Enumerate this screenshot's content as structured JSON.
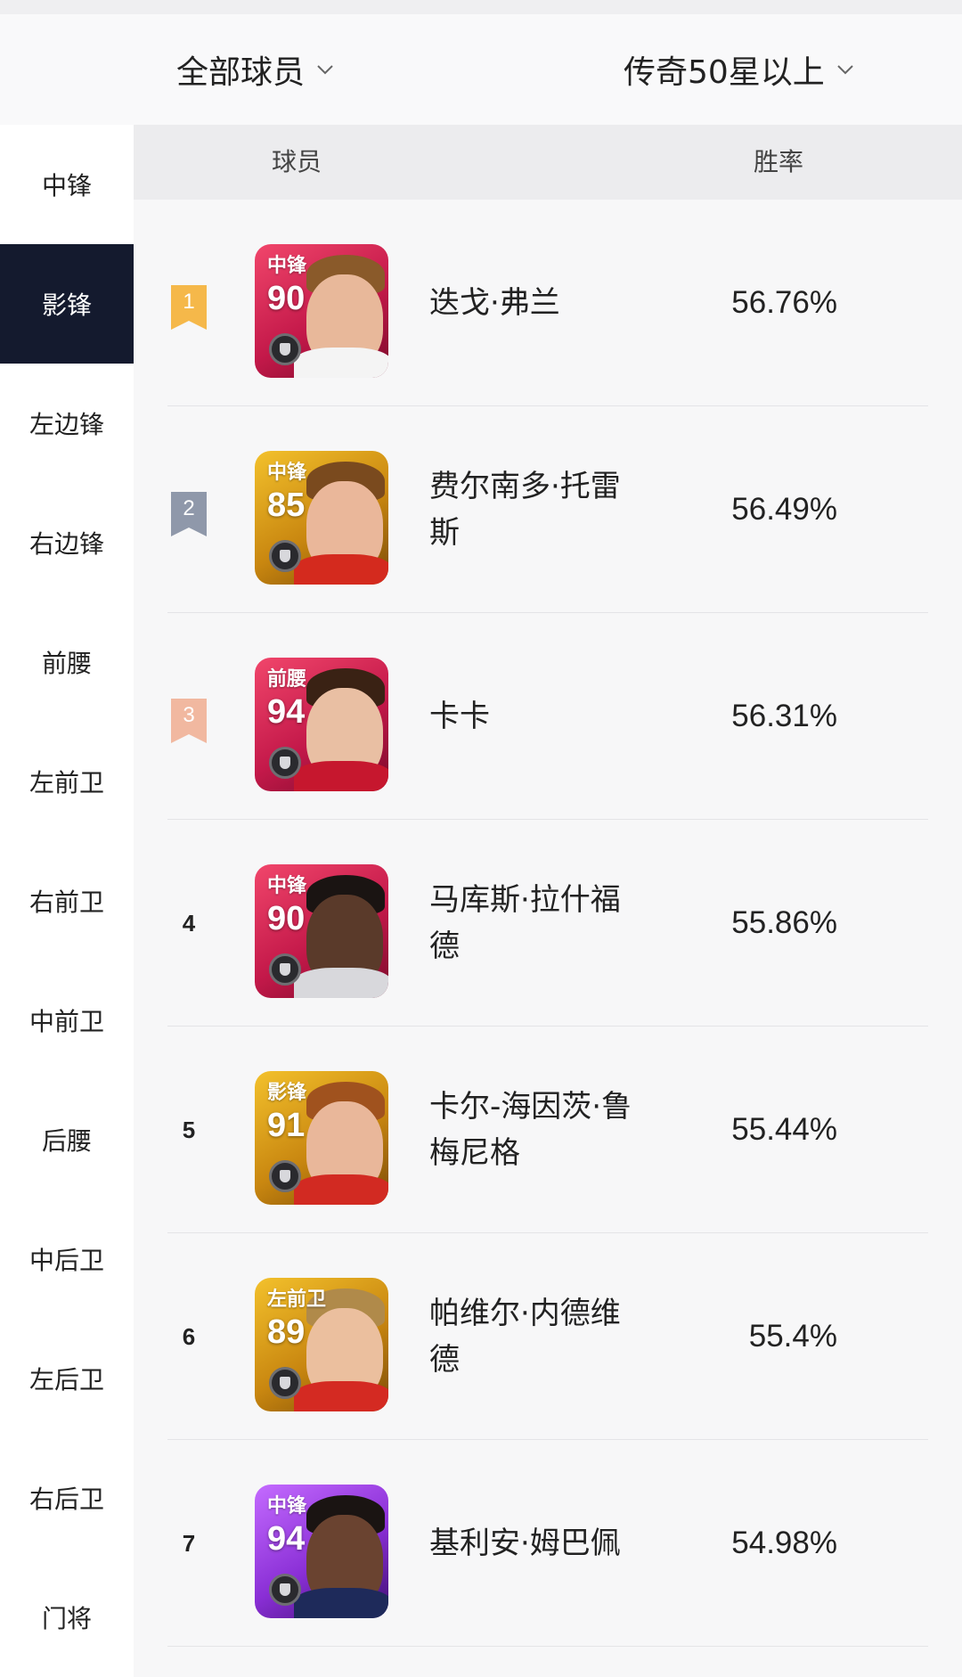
{
  "filters": {
    "player_scope": "全部球员",
    "star_filter": "传奇50星以上"
  },
  "sidebar": {
    "items": [
      {
        "label": "中锋",
        "active": false
      },
      {
        "label": "影锋",
        "active": true
      },
      {
        "label": "左边锋",
        "active": false
      },
      {
        "label": "右边锋",
        "active": false
      },
      {
        "label": "前腰",
        "active": false
      },
      {
        "label": "左前卫",
        "active": false
      },
      {
        "label": "右前卫",
        "active": false
      },
      {
        "label": "中前卫",
        "active": false
      },
      {
        "label": "后腰",
        "active": false
      },
      {
        "label": "中后卫",
        "active": false
      },
      {
        "label": "左后卫",
        "active": false
      },
      {
        "label": "右后卫",
        "active": false
      },
      {
        "label": "门将",
        "active": false
      }
    ]
  },
  "table": {
    "headers": {
      "player": "球员",
      "win_rate": "胜率"
    },
    "rows": [
      {
        "rank": "1",
        "position": "中锋",
        "rating": "90",
        "name": "迭戈·弗兰",
        "win_rate": "56.76%",
        "card_color": "red"
      },
      {
        "rank": "2",
        "position": "中锋",
        "rating": "85",
        "name": "费尔南多·托雷斯",
        "win_rate": "56.49%",
        "card_color": "gold"
      },
      {
        "rank": "3",
        "position": "前腰",
        "rating": "94",
        "name": "卡卡",
        "win_rate": "56.31%",
        "card_color": "red"
      },
      {
        "rank": "4",
        "position": "中锋",
        "rating": "90",
        "name": "马库斯·拉什福德",
        "win_rate": "55.86%",
        "card_color": "red"
      },
      {
        "rank": "5",
        "position": "影锋",
        "rating": "91",
        "name": "卡尔-海因茨·鲁梅尼格",
        "win_rate": "55.44%",
        "card_color": "gold"
      },
      {
        "rank": "6",
        "position": "左前卫",
        "rating": "89",
        "name": "帕维尔·内德维德",
        "win_rate": "55.4%",
        "card_color": "gold"
      },
      {
        "rank": "7",
        "position": "中锋",
        "rating": "94",
        "name": "基利安·姆巴佩",
        "win_rate": "54.98%",
        "card_color": "purple"
      }
    ]
  },
  "colors": {
    "active_tab_bg": "#141a2e",
    "rank1_badge": "#f5b84a",
    "rank2_badge": "#8f98aa",
    "rank3_badge": "#f1b8a0"
  },
  "icons": {
    "dropdown": "chevron-down-icon",
    "rank_badge": "ribbon-badge-icon",
    "card_emblem": "team-emblem-icon"
  }
}
